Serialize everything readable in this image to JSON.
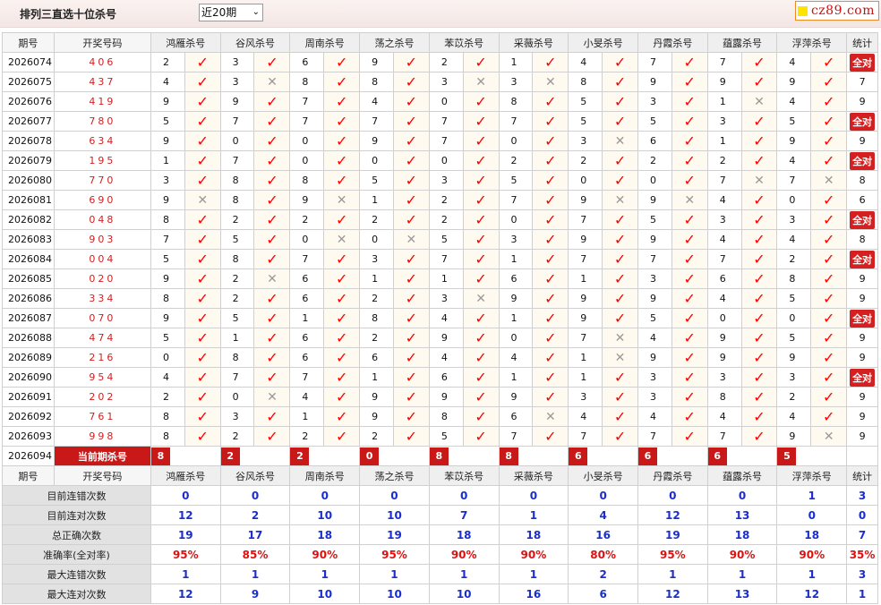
{
  "header": {
    "title": "排列三直选十位杀号",
    "range_select": "近20期",
    "logo_text": "cz89.com"
  },
  "table": {
    "col_period": "期号",
    "col_code": "开奖号码",
    "col_total": "统计",
    "experts": [
      "鸿雁杀号",
      "谷风杀号",
      "周南杀号",
      "荡之杀号",
      "苯苡杀号",
      "采薇杀号",
      "小旻杀号",
      "丹霞杀号",
      "蕴露杀号",
      "浮萍杀号"
    ],
    "rows": [
      {
        "period": "2026074",
        "code": "406",
        "kills": [
          2,
          3,
          6,
          9,
          2,
          1,
          4,
          7,
          7,
          4
        ],
        "hits": [
          1,
          1,
          1,
          1,
          1,
          1,
          1,
          1,
          1,
          1
        ],
        "stat": "全对"
      },
      {
        "period": "2026075",
        "code": "437",
        "kills": [
          4,
          3,
          8,
          8,
          3,
          3,
          8,
          9,
          9,
          9
        ],
        "hits": [
          1,
          0,
          1,
          1,
          0,
          0,
          1,
          1,
          1,
          1
        ],
        "stat": "7"
      },
      {
        "period": "2026076",
        "code": "419",
        "kills": [
          9,
          9,
          7,
          4,
          0,
          8,
          5,
          3,
          1,
          4
        ],
        "hits": [
          1,
          1,
          1,
          1,
          1,
          1,
          1,
          1,
          0,
          1
        ],
        "stat": "9"
      },
      {
        "period": "2026077",
        "code": "780",
        "kills": [
          5,
          7,
          7,
          7,
          7,
          7,
          5,
          5,
          3,
          5
        ],
        "hits": [
          1,
          1,
          1,
          1,
          1,
          1,
          1,
          1,
          1,
          1
        ],
        "stat": "全对"
      },
      {
        "period": "2026078",
        "code": "634",
        "kills": [
          9,
          0,
          0,
          9,
          7,
          0,
          3,
          6,
          1,
          9
        ],
        "hits": [
          1,
          1,
          1,
          1,
          1,
          1,
          0,
          1,
          1,
          1
        ],
        "stat": "9"
      },
      {
        "period": "2026079",
        "code": "195",
        "kills": [
          1,
          7,
          0,
          0,
          0,
          2,
          2,
          2,
          2,
          4
        ],
        "hits": [
          1,
          1,
          1,
          1,
          1,
          1,
          1,
          1,
          1,
          1
        ],
        "stat": "全对"
      },
      {
        "period": "2026080",
        "code": "770",
        "kills": [
          3,
          8,
          8,
          5,
          3,
          5,
          0,
          0,
          7,
          7
        ],
        "hits": [
          1,
          1,
          1,
          1,
          1,
          1,
          1,
          1,
          0,
          0
        ],
        "stat": "8"
      },
      {
        "period": "2026081",
        "code": "690",
        "kills": [
          9,
          8,
          9,
          1,
          2,
          7,
          9,
          9,
          4,
          0
        ],
        "hits": [
          0,
          1,
          0,
          1,
          1,
          1,
          0,
          0,
          1,
          1
        ],
        "stat": "6"
      },
      {
        "period": "2026082",
        "code": "048",
        "kills": [
          8,
          2,
          2,
          2,
          2,
          0,
          7,
          5,
          3,
          3
        ],
        "hits": [
          1,
          1,
          1,
          1,
          1,
          1,
          1,
          1,
          1,
          1
        ],
        "stat": "全对"
      },
      {
        "period": "2026083",
        "code": "903",
        "kills": [
          7,
          5,
          0,
          0,
          5,
          3,
          9,
          9,
          4,
          4
        ],
        "hits": [
          1,
          1,
          0,
          0,
          1,
          1,
          1,
          1,
          1,
          1
        ],
        "stat": "8"
      },
      {
        "period": "2026084",
        "code": "004",
        "kills": [
          5,
          8,
          7,
          3,
          7,
          1,
          7,
          7,
          7,
          2
        ],
        "hits": [
          1,
          1,
          1,
          1,
          1,
          1,
          1,
          1,
          1,
          1
        ],
        "stat": "全对"
      },
      {
        "period": "2026085",
        "code": "020",
        "kills": [
          9,
          2,
          6,
          1,
          1,
          6,
          1,
          3,
          6,
          8
        ],
        "hits": [
          1,
          0,
          1,
          1,
          1,
          1,
          1,
          1,
          1,
          1
        ],
        "stat": "9"
      },
      {
        "period": "2026086",
        "code": "334",
        "kills": [
          8,
          2,
          6,
          2,
          3,
          9,
          9,
          9,
          4,
          5
        ],
        "hits": [
          1,
          1,
          1,
          1,
          0,
          1,
          1,
          1,
          1,
          1
        ],
        "stat": "9"
      },
      {
        "period": "2026087",
        "code": "070",
        "kills": [
          9,
          5,
          1,
          8,
          4,
          1,
          9,
          5,
          0,
          0
        ],
        "hits": [
          1,
          1,
          1,
          1,
          1,
          1,
          1,
          1,
          1,
          1
        ],
        "stat": "全对"
      },
      {
        "period": "2026088",
        "code": "474",
        "kills": [
          5,
          1,
          6,
          2,
          9,
          0,
          7,
          4,
          9,
          5
        ],
        "hits": [
          1,
          1,
          1,
          1,
          1,
          1,
          0,
          1,
          1,
          1
        ],
        "stat": "9"
      },
      {
        "period": "2026089",
        "code": "216",
        "kills": [
          0,
          8,
          6,
          6,
          4,
          4,
          1,
          9,
          9,
          9
        ],
        "hits": [
          1,
          1,
          1,
          1,
          1,
          1,
          0,
          1,
          1,
          1
        ],
        "stat": "9"
      },
      {
        "period": "2026090",
        "code": "954",
        "kills": [
          4,
          7,
          7,
          1,
          6,
          1,
          1,
          3,
          3,
          3
        ],
        "hits": [
          1,
          1,
          1,
          1,
          1,
          1,
          1,
          1,
          1,
          1
        ],
        "stat": "全对"
      },
      {
        "period": "2026091",
        "code": "202",
        "kills": [
          2,
          0,
          4,
          9,
          9,
          9,
          3,
          3,
          8,
          2
        ],
        "hits": [
          1,
          0,
          1,
          1,
          1,
          1,
          1,
          1,
          1,
          1
        ],
        "stat": "9"
      },
      {
        "period": "2026092",
        "code": "761",
        "kills": [
          8,
          3,
          1,
          9,
          8,
          6,
          4,
          4,
          4,
          4
        ],
        "hits": [
          1,
          1,
          1,
          1,
          1,
          0,
          1,
          1,
          1,
          1
        ],
        "stat": "9"
      },
      {
        "period": "2026093",
        "code": "998",
        "kills": [
          8,
          2,
          2,
          2,
          5,
          7,
          7,
          7,
          7,
          9
        ],
        "hits": [
          1,
          1,
          1,
          1,
          1,
          1,
          1,
          1,
          1,
          0
        ],
        "stat": "9"
      }
    ],
    "current": {
      "period": "2026094",
      "label": "当前期杀号",
      "kills": [
        "8",
        "2",
        "2",
        "0",
        "8",
        "8",
        "6",
        "6",
        "6",
        "5"
      ]
    }
  },
  "summary": {
    "rows": [
      {
        "label": "目前连错次数",
        "values": [
          "0",
          "0",
          "0",
          "0",
          "0",
          "0",
          "0",
          "0",
          "0",
          "1"
        ],
        "total": "3",
        "type": "num"
      },
      {
        "label": "目前连对次数",
        "values": [
          "12",
          "2",
          "10",
          "10",
          "7",
          "1",
          "4",
          "12",
          "13",
          "0"
        ],
        "total": "0",
        "type": "num"
      },
      {
        "label": "总正确次数",
        "values": [
          "19",
          "17",
          "18",
          "19",
          "18",
          "18",
          "16",
          "19",
          "18",
          "18"
        ],
        "total": "7",
        "type": "num"
      },
      {
        "label": "准确率(全对率)",
        "values": [
          "95%",
          "85%",
          "90%",
          "95%",
          "90%",
          "90%",
          "80%",
          "95%",
          "90%",
          "90%"
        ],
        "total": "35%",
        "type": "rate"
      },
      {
        "label": "最大连错次数",
        "values": [
          "1",
          "1",
          "1",
          "1",
          "1",
          "1",
          "2",
          "1",
          "1",
          "1"
        ],
        "total": "3",
        "type": "num"
      },
      {
        "label": "最大连对次数",
        "values": [
          "12",
          "9",
          "10",
          "10",
          "10",
          "16",
          "6",
          "12",
          "13",
          "12"
        ],
        "total": "1",
        "type": "num"
      }
    ]
  },
  "colors": {
    "accent_red": "#c81818",
    "check_red": "#ff0000",
    "summary_blue": "#1a2ecc"
  },
  "icons": {
    "hit": "check-mark-icon",
    "miss": "cross-mark-icon"
  }
}
